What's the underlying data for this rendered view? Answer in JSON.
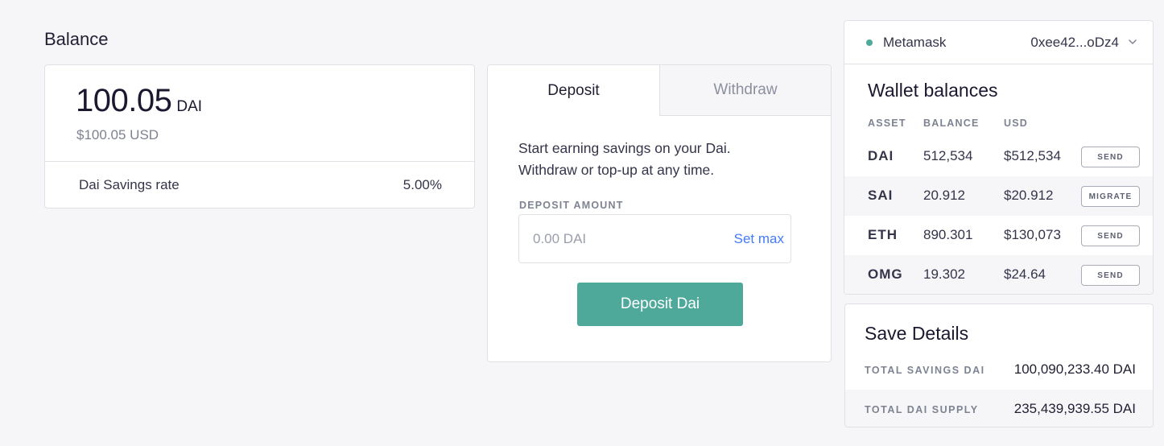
{
  "balance": {
    "section_title": "Balance",
    "amount": "100.05",
    "unit": "DAI",
    "usd": "$100.05 USD",
    "rate_label": "Dai Savings rate",
    "rate_value": "5.00%"
  },
  "deposit": {
    "tabs": [
      {
        "label": "Deposit",
        "active": true
      },
      {
        "label": "Withdraw",
        "active": false
      }
    ],
    "description_line1": "Start earning savings on your Dai.",
    "description_line2": "Withdraw or top-up at any time.",
    "amount_label": "DEPOSIT AMOUNT",
    "amount_placeholder": "0.00 DAI",
    "set_max_label": "Set max",
    "button_label": "Deposit Dai"
  },
  "wallet": {
    "provider": "Metamask",
    "address": "0xee42...oDz4",
    "status_color": "#4fa99a",
    "title": "Wallet balances",
    "columns": [
      "ASSET",
      "BALANCE",
      "USD"
    ],
    "rows": [
      {
        "asset": "DAI",
        "balance": "512,534",
        "usd": "$512,534",
        "action": "SEND"
      },
      {
        "asset": "SAI",
        "balance": "20.912",
        "usd": "$20.912",
        "action": "MIGRATE"
      },
      {
        "asset": "ETH",
        "balance": "890.301",
        "usd": "$130,073",
        "action": "SEND"
      },
      {
        "asset": "OMG",
        "balance": "19.302",
        "usd": "$24.64",
        "action": "SEND"
      }
    ]
  },
  "save_details": {
    "title": "Save Details",
    "rows": [
      {
        "label": "TOTAL SAVINGS DAI",
        "value": "100,090,233.40 DAI"
      },
      {
        "label": "TOTAL DAI SUPPLY",
        "value": "235,439,939.55 DAI"
      }
    ]
  },
  "colors": {
    "accent": "#4fa99a",
    "link": "#447afb",
    "background": "#f6f6f9"
  }
}
